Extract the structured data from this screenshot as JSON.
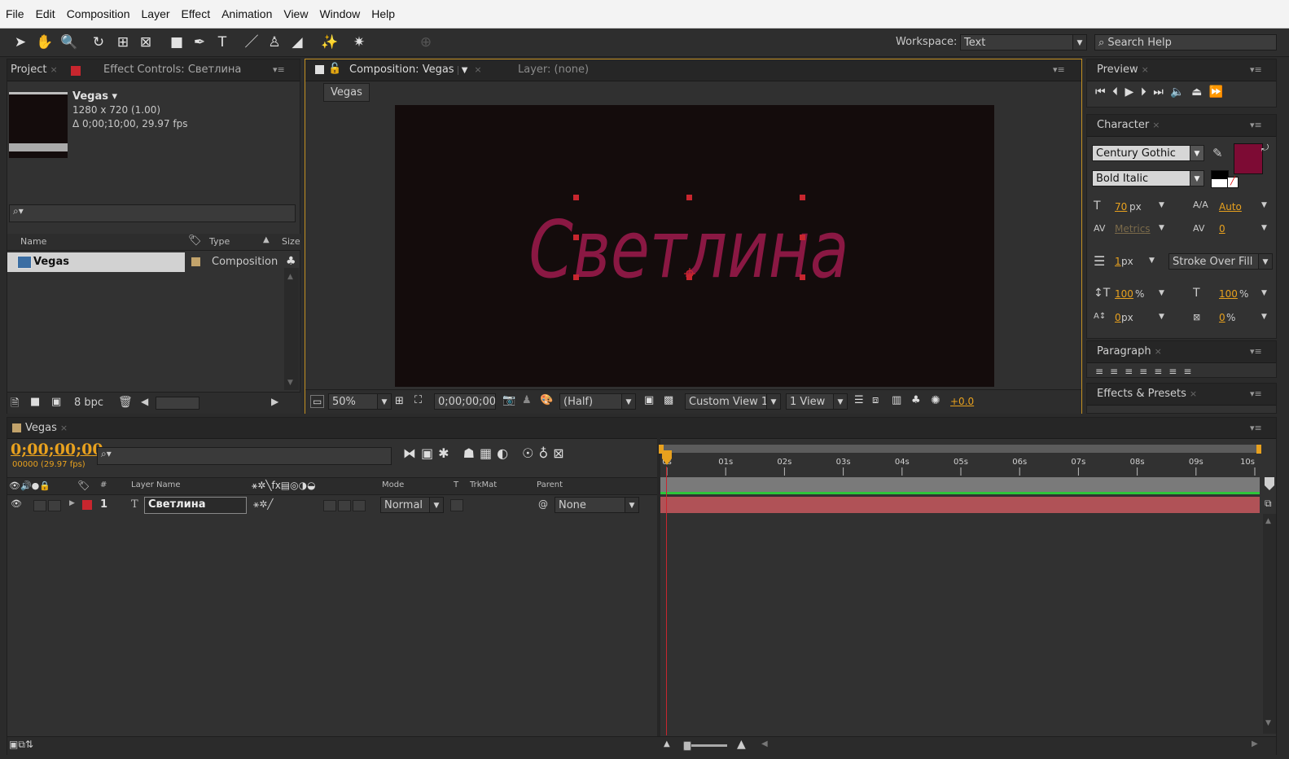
{
  "menu": [
    "File",
    "Edit",
    "Composition",
    "Layer",
    "Effect",
    "Animation",
    "View",
    "Window",
    "Help"
  ],
  "toolbar": {
    "workspace_label": "Workspace:",
    "workspace_value": "Text",
    "search_placeholder": "Search Help"
  },
  "project": {
    "tab_project": "Project",
    "tab_effect_controls": "Effect Controls: Светлина",
    "comp_name": "Vegas ▾",
    "comp_size": "1280 x 720 (1.00)",
    "comp_duration": "Δ 0;00;10;00, 29.97 fps",
    "col_name": "Name",
    "col_type": "Type",
    "col_size": "Size",
    "item_name": "Vegas",
    "item_type": "Composition",
    "bpc": "8 bpc"
  },
  "composition": {
    "tab_comp": "Composition: Vegas",
    "tab_layer": "Layer: (none)",
    "breadcrumb": "Vegas",
    "text": "Светлина",
    "text_color": "#8a1843",
    "bg_color": "#140c0c",
    "zoom": "50%",
    "timecode": "0;00;00;00",
    "resolution": "(Half)",
    "view": "Custom View 1",
    "views": "1 View",
    "exposure": "+0.0"
  },
  "preview": {
    "tab": "Preview"
  },
  "character": {
    "tab": "Character",
    "font": "Century Gothic",
    "style": "Bold Italic",
    "size": "70",
    "size_unit": "px",
    "leading": "Auto",
    "kerning": "Metrics",
    "tracking": "0",
    "stroke": "1",
    "stroke_unit": "px",
    "stroke_mode": "Stroke Over Fill",
    "vscale": "100",
    "hscale": "100",
    "pct": "%",
    "baseline": "0",
    "baseline_unit": "px",
    "tsume": "0",
    "tsume_unit": "%",
    "fill_color": "#7d0b34"
  },
  "paragraph": {
    "tab": "Paragraph"
  },
  "effects": {
    "tab": "Effects & Presets"
  },
  "timeline": {
    "tab": "Vegas",
    "timecode": "0;00;00;00",
    "fps": "00000 (29.97 fps)",
    "col_layer_name": "Layer Name",
    "col_mode": "Mode",
    "col_t": "T",
    "col_trkmat": "TrkMat",
    "col_parent": "Parent",
    "col_num": "#",
    "layer_num": "1",
    "layer_name": "Светлина",
    "layer_mode": "Normal",
    "layer_parent": "None",
    "layer_color": "#c8262e",
    "ruler": [
      "0s",
      "01s",
      "02s",
      "03s",
      "04s",
      "05s",
      "06s",
      "07s",
      "08s",
      "09s",
      "10s"
    ]
  }
}
